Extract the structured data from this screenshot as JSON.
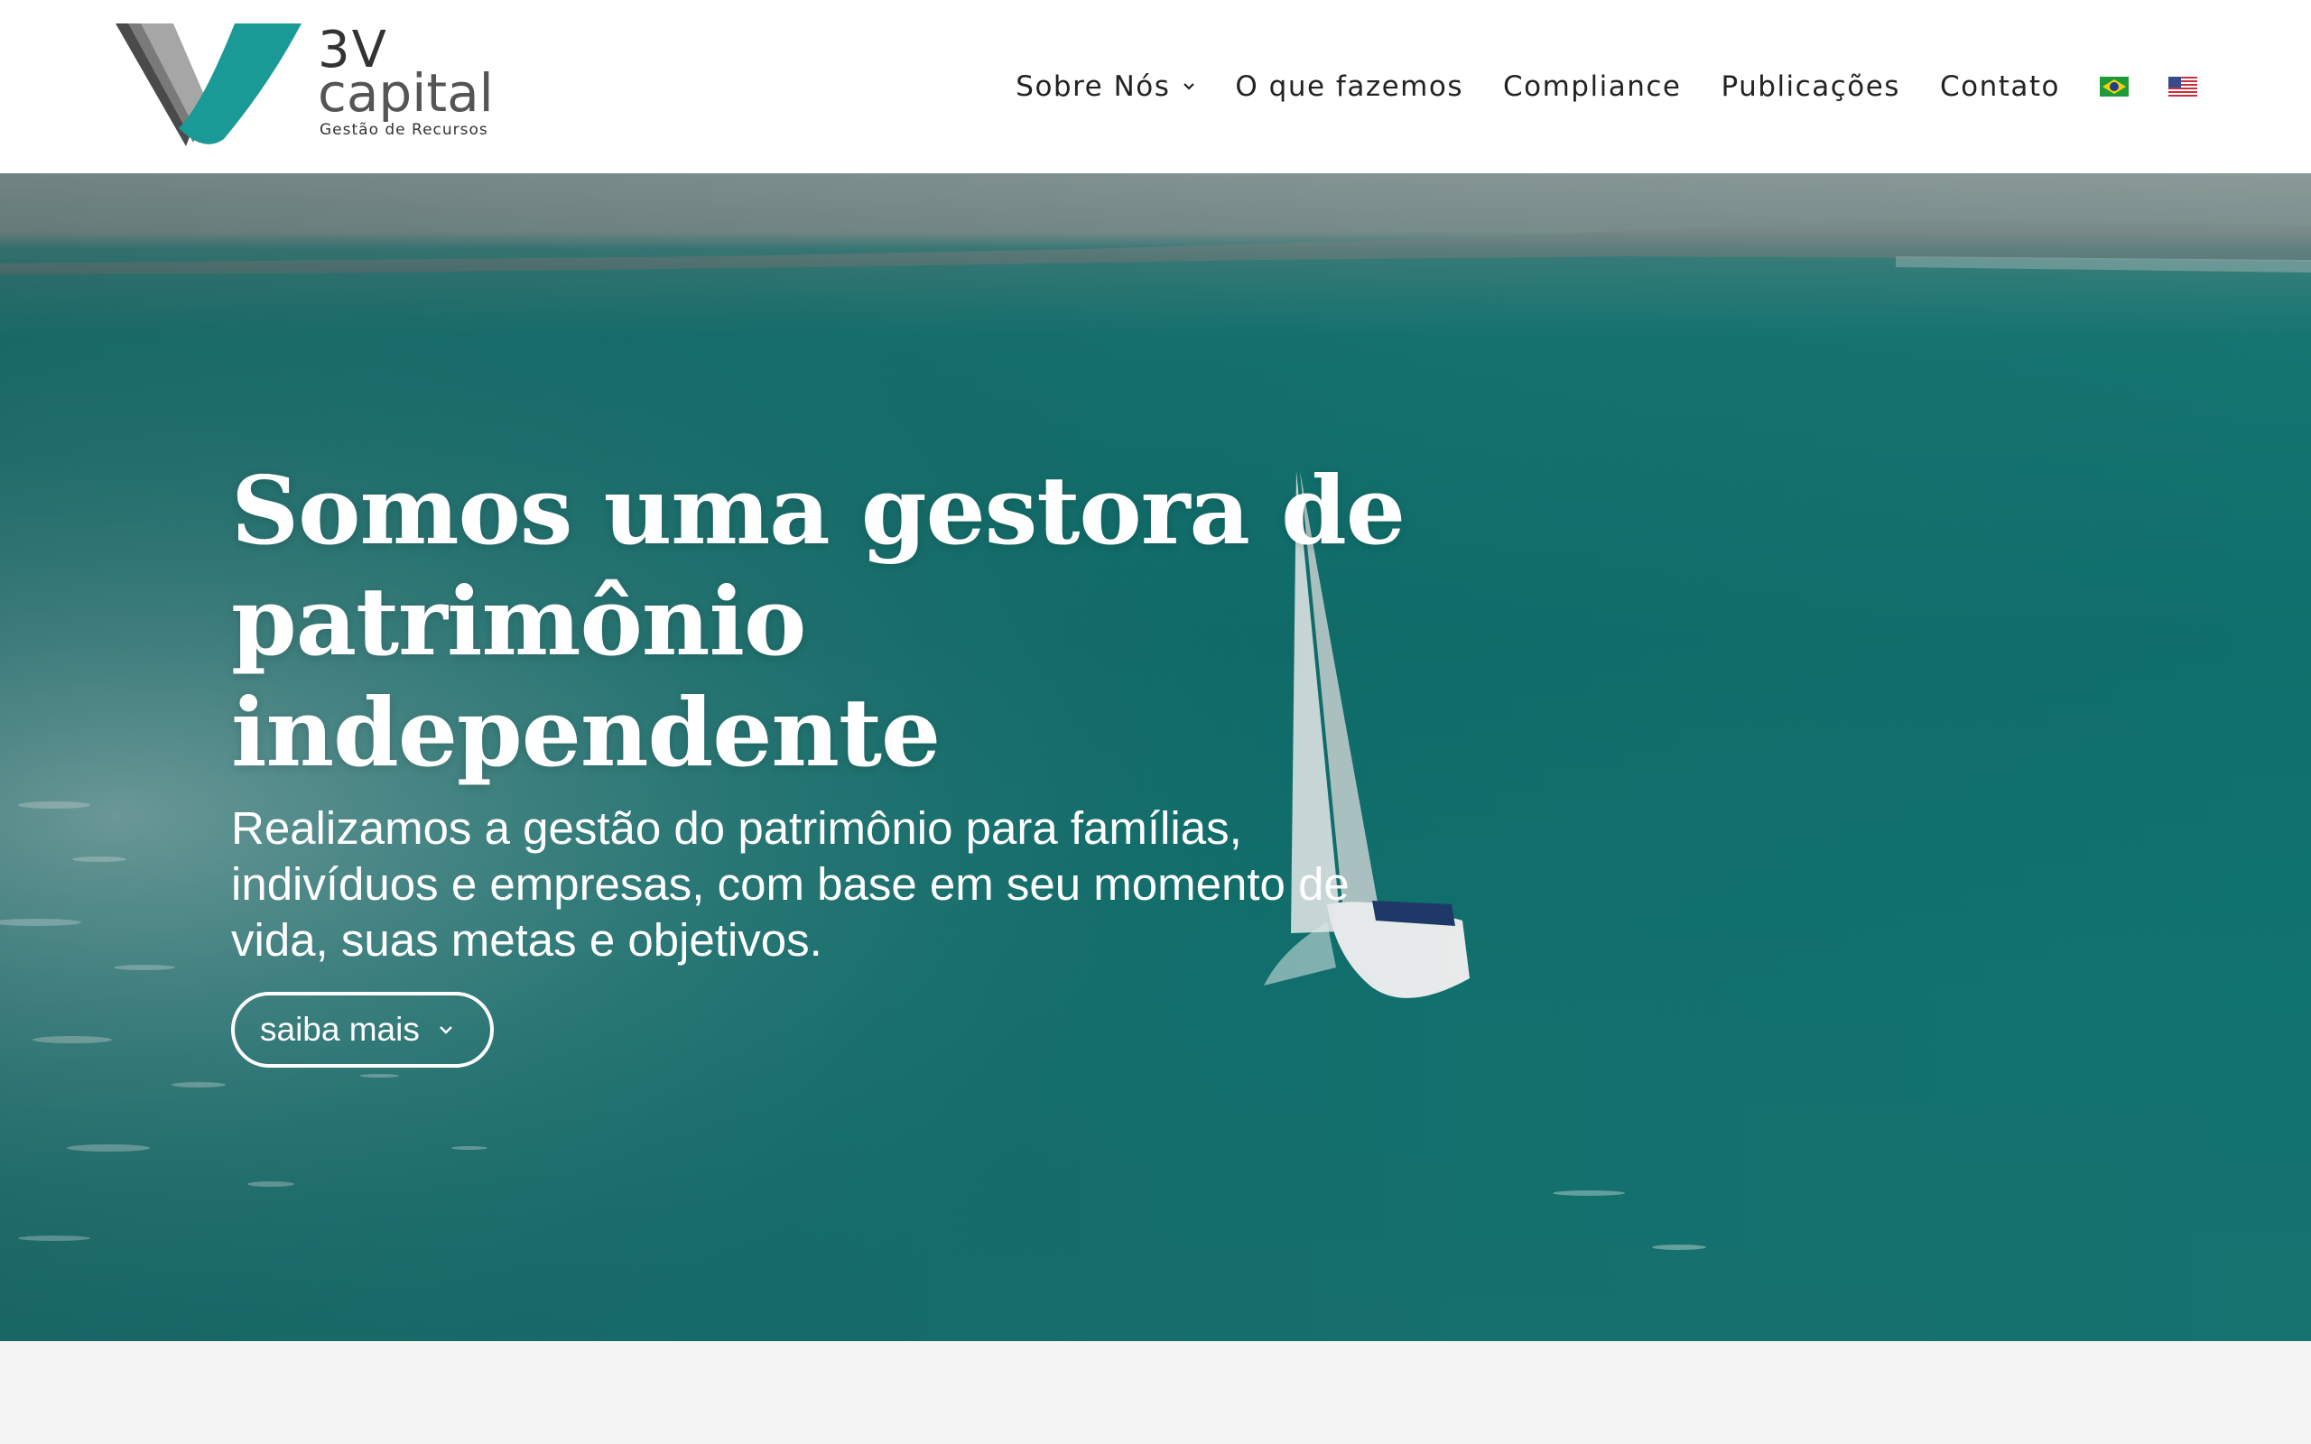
{
  "logo": {
    "line1": "3V",
    "line2": "capital",
    "tagline": "Gestão de Recursos"
  },
  "nav": {
    "items": [
      {
        "label": "Sobre Nós",
        "has_dropdown": true
      },
      {
        "label": "O que fazemos"
      },
      {
        "label": "Compliance"
      },
      {
        "label": "Publicações"
      },
      {
        "label": "Contato"
      }
    ],
    "languages": [
      {
        "icon": "brazil-flag-icon"
      },
      {
        "icon": "us-flag-icon"
      }
    ]
  },
  "hero": {
    "title_lines": [
      "Somos uma gestora de",
      "patrimônio",
      "independente"
    ],
    "subtitle": "Realizamos a gestão do patrimônio para famílias, indivíduos e empresas, com base em seu momento de vida, suas metas e objetivos.",
    "button_label": "saiba mais",
    "button_icon": "chevron-down-icon"
  },
  "colors": {
    "brand_teal": "#1a9a96",
    "sea": "#0f6f6c",
    "header_bg": "#ffffff",
    "footer_band": "#f4f4f4"
  }
}
